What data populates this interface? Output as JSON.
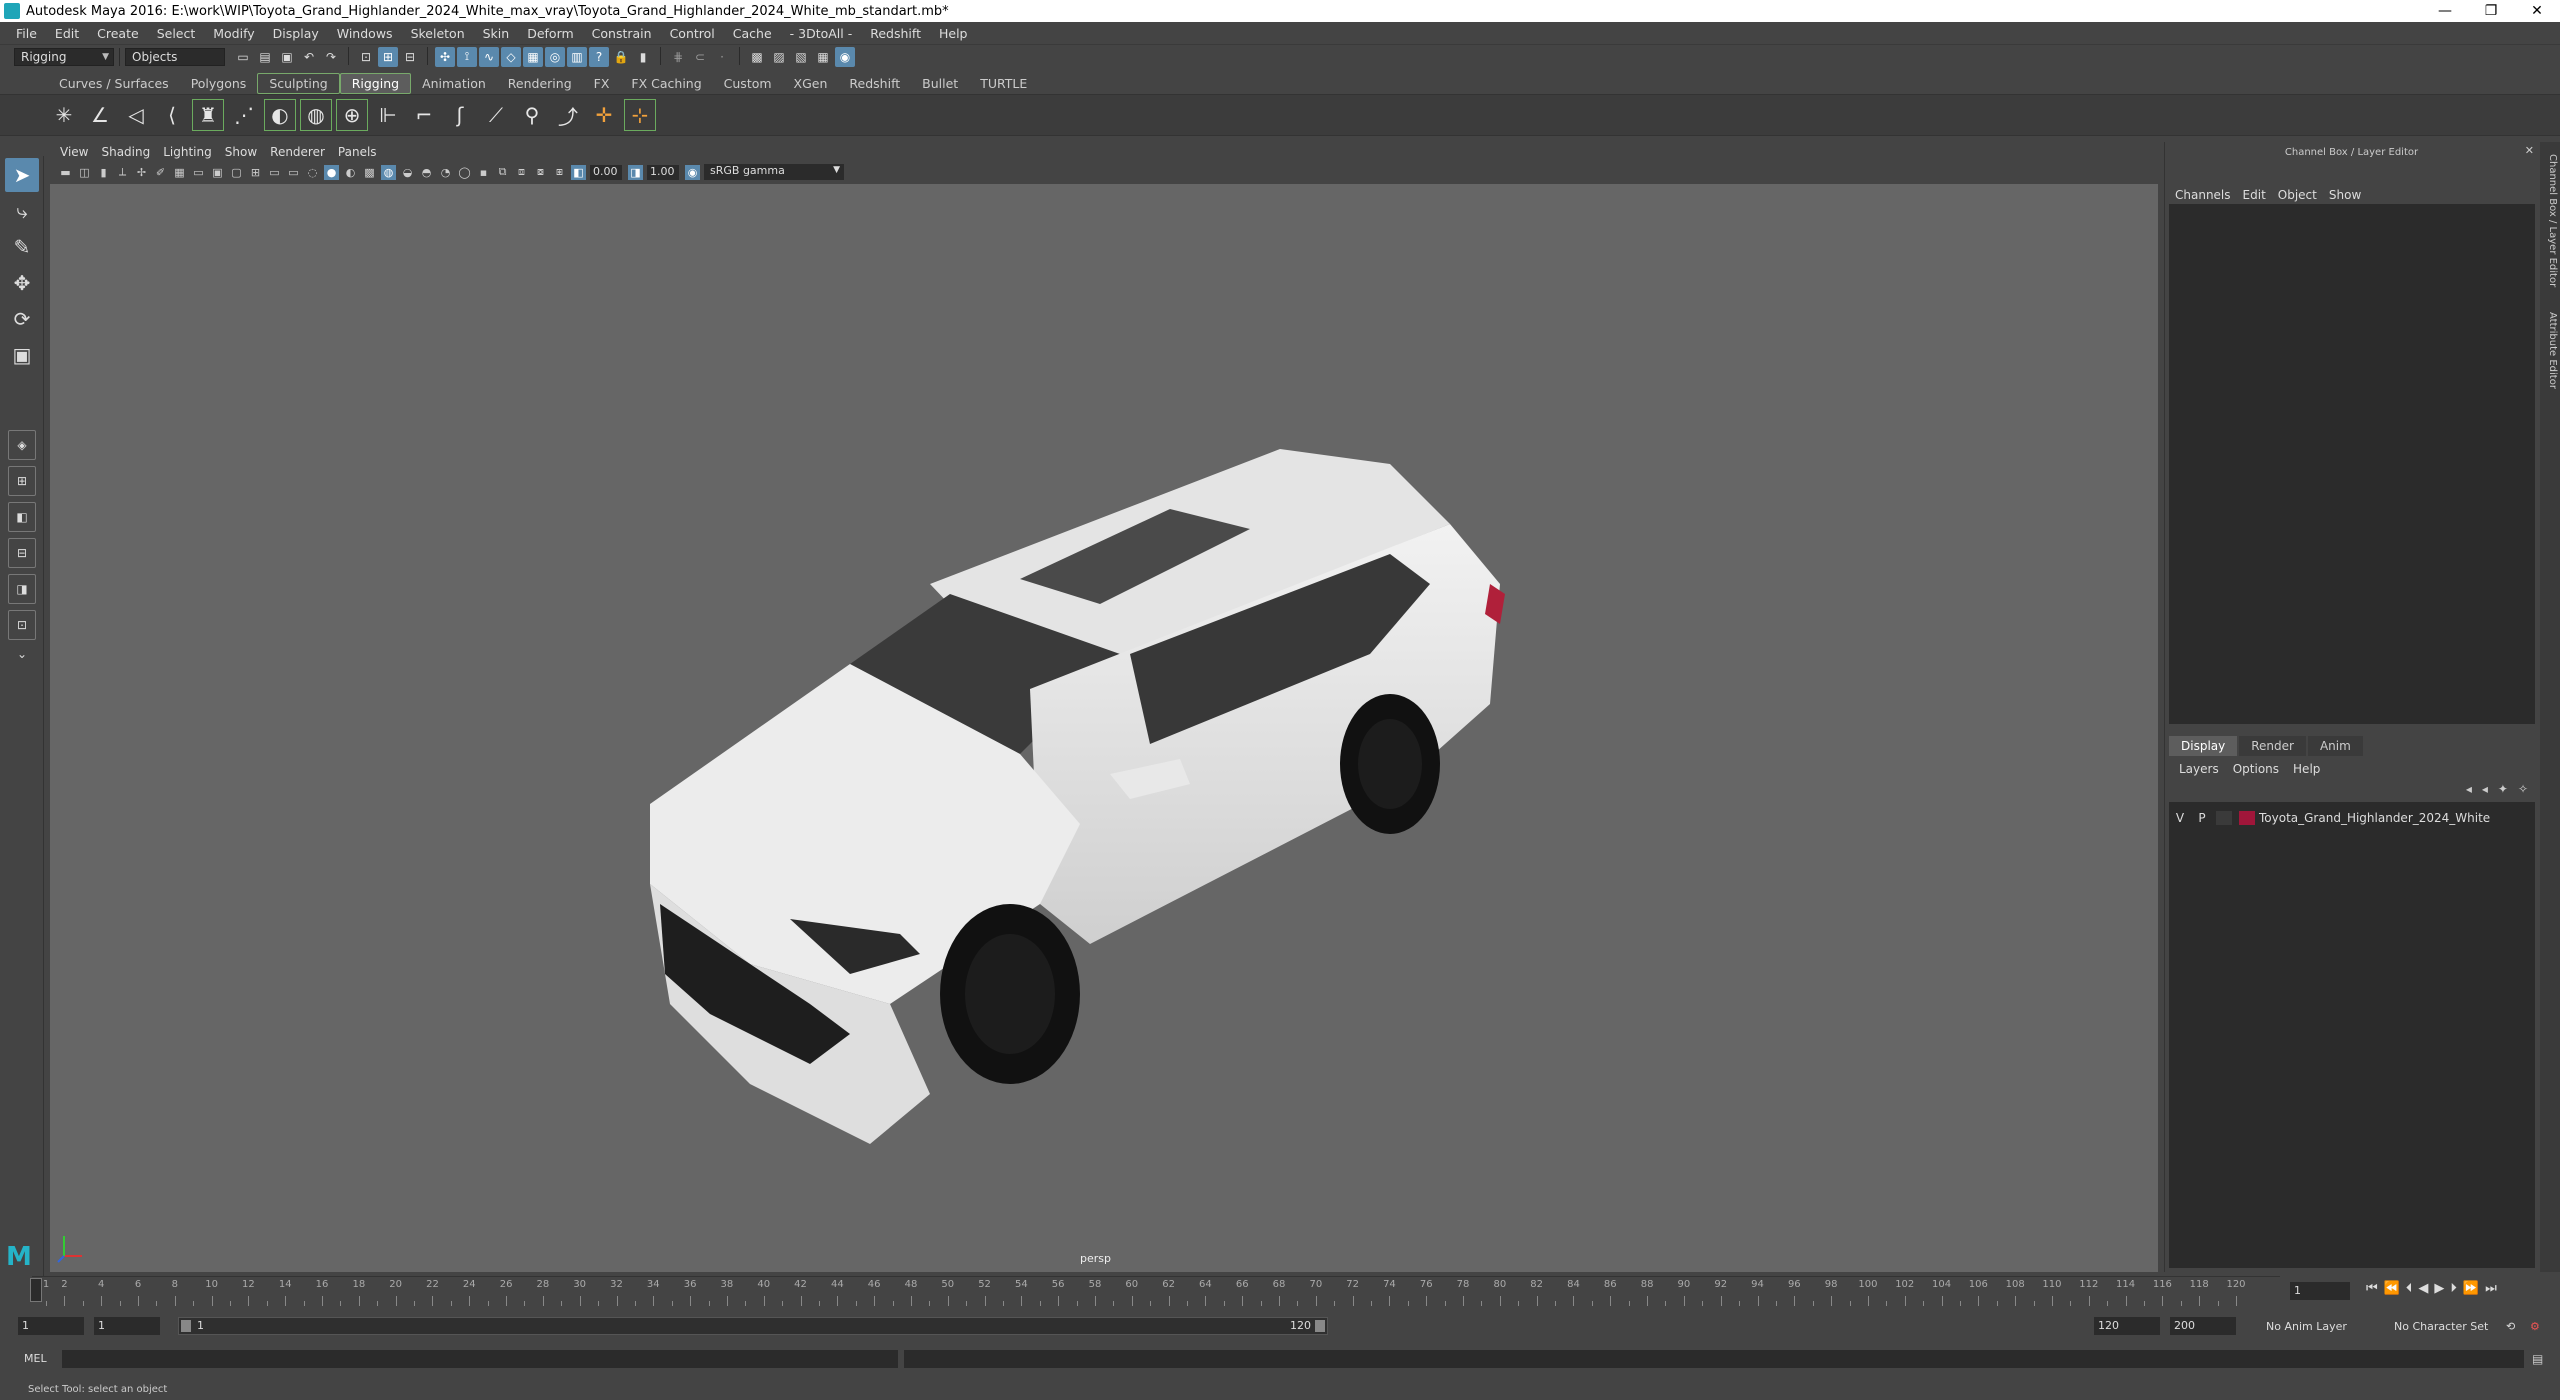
{
  "window": {
    "title": "Autodesk Maya 2016: E:\\work\\WIP\\Toyota_Grand_Highlander_2024_White_max_vray\\Toyota_Grand_Highlander_2024_White_mb_standart.mb*",
    "minimize": "—",
    "restore": "❐",
    "close": "✕"
  },
  "menubar": [
    "File",
    "Edit",
    "Create",
    "Select",
    "Modify",
    "Display",
    "Windows",
    "Skeleton",
    "Skin",
    "Deform",
    "Constrain",
    "Control",
    "Cache",
    "- 3DtoAll -",
    "Redshift",
    "Help"
  ],
  "statusline": {
    "menu_set": "Rigging",
    "selection_mode": "Objects"
  },
  "shelf_tabs": [
    "Curves / Surfaces",
    "Polygons",
    "Sculpting",
    "Rigging",
    "Animation",
    "Rendering",
    "FX",
    "FX Caching",
    "Custom",
    "XGen",
    "Redshift",
    "Bullet",
    "TURTLE"
  ],
  "shelf_active": "Rigging",
  "panel_menu": [
    "View",
    "Shading",
    "Lighting",
    "Show",
    "Renderer",
    "Panels"
  ],
  "viewport_toolbar": {
    "exposure": "0.00",
    "gamma": "1.00",
    "color_space": "sRGB gamma"
  },
  "viewport": {
    "camera_label": "persp"
  },
  "channel_box": {
    "title": "Channel Box / Layer Editor",
    "menu": [
      "Channels",
      "Edit",
      "Object",
      "Show"
    ]
  },
  "layer_editor": {
    "tabs": [
      "Display",
      "Render",
      "Anim"
    ],
    "active_tab": "Display",
    "menu": [
      "Layers",
      "Options",
      "Help"
    ],
    "layers": [
      {
        "visible": "V",
        "playback": "P",
        "name": "Toyota_Grand_Highlander_2024_White",
        "color": "#a0163a"
      }
    ]
  },
  "right_tabs": {
    "channel_box": "Channel Box / Layer Editor",
    "attribute_editor": "Attribute Editor"
  },
  "time_slider": {
    "ticks": [
      1,
      2,
      4,
      6,
      8,
      10,
      12,
      14,
      16,
      18,
      20,
      22,
      24,
      26,
      28,
      30,
      32,
      34,
      36,
      38,
      40,
      42,
      44,
      46,
      48,
      50,
      52,
      54,
      56,
      58,
      60,
      62,
      64,
      66,
      68,
      70,
      72,
      74,
      76,
      78,
      80,
      82,
      84,
      86,
      88,
      90,
      92,
      94,
      96,
      98,
      100,
      102,
      104,
      106,
      108,
      110,
      112,
      114,
      116,
      118,
      120
    ],
    "current_frame": "1"
  },
  "range_slider": {
    "start_time": "1",
    "playback_start": "1",
    "range_start_label": "1",
    "range_end_label": "120",
    "playback_end": "120",
    "end_time": "200",
    "anim_layer": "No Anim Layer",
    "character_set": "No Character Set"
  },
  "command_line": {
    "language": "MEL"
  },
  "help_line": "Select Tool: select an object"
}
